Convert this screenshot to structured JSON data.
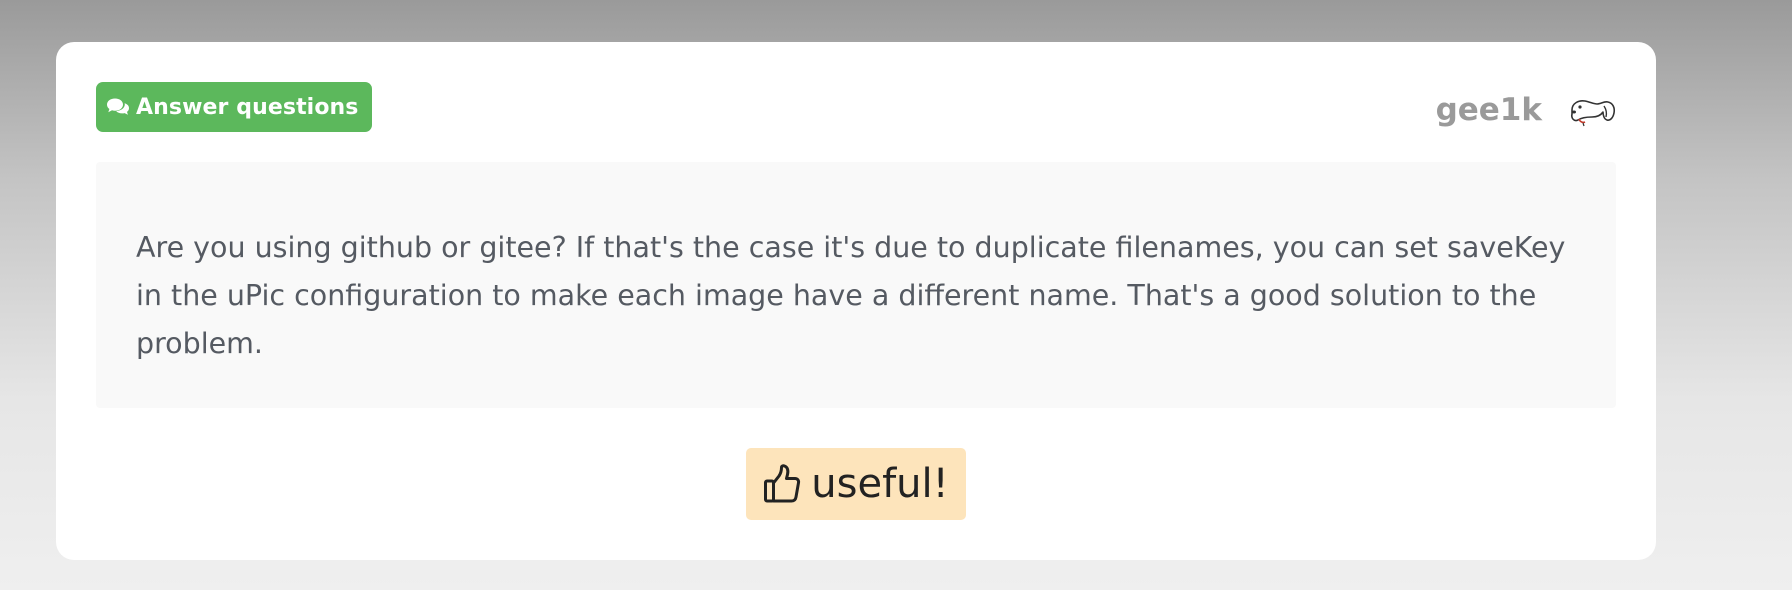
{
  "answer": {
    "badge_label": "Answer questions",
    "badge_icon": "comments-icon",
    "badge_color": "#5cb85c",
    "author": "gee1k",
    "avatar_icon": "dog-avatar",
    "text": "Are you using github or gitee? If that's the case it's due to duplicate filenames, you can set saveKey in the uPic configuration to make each image have a different name. That's a good solution to the problem.",
    "useful_label": "useful!",
    "useful_icon": "thumbs-up-icon",
    "useful_color": "#fde4bb"
  }
}
